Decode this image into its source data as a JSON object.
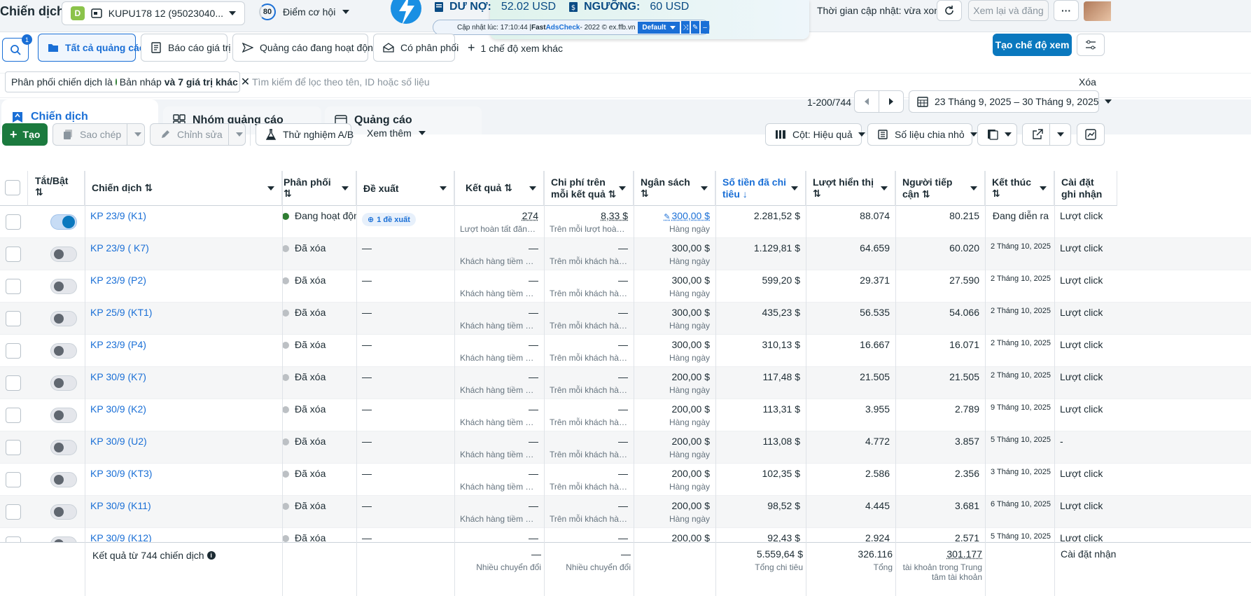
{
  "header": {
    "title": "Chiến dịch",
    "account_badge": "D",
    "account_name": "KUPU178 12 (95023040...",
    "score": "80",
    "opportunity_label": "Điểm cơ hội",
    "update_time": "Thời gian cập nhật: vừa xong",
    "review_publish": "Xem lại và đăng",
    "more": "···"
  },
  "adscheck": {
    "debt_label": "DƯ NỢ:",
    "debt_value": "52.02 USD",
    "threshold_label": "NGƯỠNG:",
    "threshold_value": "60 USD",
    "update_prefix": "Cập nhật lúc: 17:10:44 | ",
    "brand_fast": "Fast ",
    "brand_ads": "AdsCheck",
    "update_suffix": " - 2022 © ex.ffb.vn",
    "profile": "Default"
  },
  "toolbar": {
    "search_badge": "1",
    "views": [
      "Tất cả quảng cáo",
      "Báo cáo giá trị",
      "Quảng cáo đang hoạt động",
      "Có phân phối"
    ],
    "more_views": "1 chế độ xem khác",
    "create_view": "Tạo chế độ xem"
  },
  "filter": {
    "chip_prefix": "Phân phối chiến dịch là",
    "chip_value": "Bản nháp",
    "chip_suffix": "và 7 giá trị khác",
    "placeholder": "Tìm kiếm để lọc theo tên, ID hoặc số liệu",
    "clear": "Xóa"
  },
  "tabs": [
    "Chiến dịch",
    "Nhóm quảng cáo",
    "Quảng cáo"
  ],
  "pagination": {
    "range": "1-200/744",
    "date_range": "23 Tháng 9, 2025 – 30 Tháng 9, 2025"
  },
  "actions": {
    "create": "Tạo",
    "duplicate": "Sao chép",
    "edit": "Chỉnh sửa",
    "ab_test": "Thử nghiệm A/B",
    "see_more": "Xem thêm",
    "columns": "Cột: Hiệu quả",
    "breakdown": "Số liệu chia nhỏ"
  },
  "columns": {
    "toggle": "Tắt/Bật ⇅",
    "campaign": "Chiến dịch ⇅",
    "delivery": "Phân phối ⇅",
    "recommendations": "Đề xuất",
    "results": "Kết quả ⇅",
    "cost_per_result": "Chi phí trên mỗi kết quả ⇅",
    "budget": "Ngân sách ⇅",
    "amount_spent": "Số tiền đã chi tiêu ↓",
    "impressions": "Lượt hiển thị ⇅",
    "reach": "Người tiếp cận ⇅",
    "ends": "Kết thúc ⇅",
    "attribution": "Cài đặt ghi nhận"
  },
  "rows": [
    {
      "name": "KP 23/9 (K1)",
      "on": true,
      "status": "Đang hoạt động",
      "status_color": "#2e7d32",
      "rec": "1 đề xuất",
      "result": "274",
      "result_sub": "Lượt hoàn tất đăng ký",
      "cpr": "8,33 $",
      "cpr_sub": "Trên mỗi lượt hoàn tất",
      "budget": "300,00 $",
      "budget_sub": "Hàng ngày",
      "spent": "2.281,52 $",
      "impr": "88.074",
      "reach": "80.215",
      "ends": "Đang diễn ra",
      "attr": "Lượt click"
    },
    {
      "name": "KP 23/9 ( K7)",
      "on": false,
      "status": "Đã xóa",
      "status_color": "#bcc0c4",
      "rec": "—",
      "result": "—",
      "result_sub": "Khách hàng tiềm năng",
      "cpr": "—",
      "cpr_sub": "Trên mỗi khách hàng tiềm năng",
      "budget": "300,00 $",
      "budget_sub": "Hàng ngày",
      "spent": "1.129,81 $",
      "impr": "64.659",
      "reach": "60.020",
      "ends": "2 Tháng 10, 2025",
      "attr": "Lượt click"
    },
    {
      "name": "KP 23/9 (P2)",
      "on": false,
      "status": "Đã xóa",
      "status_color": "#bcc0c4",
      "rec": "—",
      "result": "—",
      "result_sub": "Khách hàng tiềm năng",
      "cpr": "—",
      "cpr_sub": "Trên mỗi khách hàng tiềm năng",
      "budget": "300,00 $",
      "budget_sub": "Hàng ngày",
      "spent": "599,20 $",
      "impr": "29.371",
      "reach": "27.590",
      "ends": "2 Tháng 10, 2025",
      "attr": "Lượt click"
    },
    {
      "name": "KP 25/9 (KT1)",
      "on": false,
      "status": "Đã xóa",
      "status_color": "#bcc0c4",
      "rec": "—",
      "result": "—",
      "result_sub": "Khách hàng tiềm năng",
      "cpr": "—",
      "cpr_sub": "Trên mỗi khách hàng tiềm năng",
      "budget": "300,00 $",
      "budget_sub": "Hàng ngày",
      "spent": "435,23 $",
      "impr": "56.535",
      "reach": "54.066",
      "ends": "2 Tháng 10, 2025",
      "attr": "Lượt click"
    },
    {
      "name": "KP 23/9 (P4)",
      "on": false,
      "status": "Đã xóa",
      "status_color": "#bcc0c4",
      "rec": "—",
      "result": "—",
      "result_sub": "Khách hàng tiềm năng",
      "cpr": "—",
      "cpr_sub": "Trên mỗi khách hàng tiềm năng",
      "budget": "300,00 $",
      "budget_sub": "Hàng ngày",
      "spent": "310,13 $",
      "impr": "16.667",
      "reach": "16.071",
      "ends": "2 Tháng 10, 2025",
      "attr": "Lượt click"
    },
    {
      "name": "KP 30/9 (K7)",
      "on": false,
      "status": "Đã xóa",
      "status_color": "#bcc0c4",
      "rec": "—",
      "result": "—",
      "result_sub": "Khách hàng tiềm năng",
      "cpr": "—",
      "cpr_sub": "Trên mỗi khách hàng tiềm năng",
      "budget": "200,00 $",
      "budget_sub": "Hàng ngày",
      "spent": "117,48 $",
      "impr": "21.505",
      "reach": "21.505",
      "ends": "2 Tháng 10, 2025",
      "attr": "Lượt click"
    },
    {
      "name": "KP 30/9 (K2)",
      "on": false,
      "status": "Đã xóa",
      "status_color": "#bcc0c4",
      "rec": "—",
      "result": "—",
      "result_sub": "Khách hàng tiềm năng",
      "cpr": "—",
      "cpr_sub": "Trên mỗi khách hàng tiềm năng",
      "budget": "200,00 $",
      "budget_sub": "Hàng ngày",
      "spent": "113,31 $",
      "impr": "3.955",
      "reach": "2.789",
      "ends": "9 Tháng 10, 2025",
      "attr": "Lượt click"
    },
    {
      "name": "KP 30/9 (U2)",
      "on": false,
      "status": "Đã xóa",
      "status_color": "#bcc0c4",
      "rec": "—",
      "result": "—",
      "result_sub": "Khách hàng tiềm năng",
      "cpr": "—",
      "cpr_sub": "Trên mỗi khách hàng tiềm năng",
      "budget": "200,00 $",
      "budget_sub": "Hàng ngày",
      "spent": "113,08 $",
      "impr": "4.772",
      "reach": "3.857",
      "ends": "5 Tháng 10, 2025",
      "attr": "-"
    },
    {
      "name": "KP 30/9 (KT3)",
      "on": false,
      "status": "Đã xóa",
      "status_color": "#bcc0c4",
      "rec": "—",
      "result": "—",
      "result_sub": "Khách hàng tiềm năng",
      "cpr": "—",
      "cpr_sub": "Trên mỗi khách hàng tiềm năng",
      "budget": "200,00 $",
      "budget_sub": "Hàng ngày",
      "spent": "102,35 $",
      "impr": "2.586",
      "reach": "2.356",
      "ends": "3 Tháng 10, 2025",
      "attr": "Lượt click"
    },
    {
      "name": "KP 30/9 (K11)",
      "on": false,
      "status": "Đã xóa",
      "status_color": "#bcc0c4",
      "rec": "—",
      "result": "—",
      "result_sub": "Khách hàng tiềm năng",
      "cpr": "—",
      "cpr_sub": "Trên mỗi khách hàng tiềm năng",
      "budget": "200,00 $",
      "budget_sub": "Hàng ngày",
      "spent": "98,52 $",
      "impr": "4.445",
      "reach": "3.681",
      "ends": "6 Tháng 10, 2025",
      "attr": "Lượt click"
    },
    {
      "name": "KP 30/9 (K12)",
      "on": false,
      "status": "Đã xóa",
      "status_color": "#bcc0c4",
      "rec": "—",
      "result": "—",
      "result_sub": "",
      "cpr": "—",
      "cpr_sub": "",
      "budget": "200,00 $",
      "budget_sub": "",
      "spent": "92,43 $",
      "impr": "2.924",
      "reach": "2.571",
      "ends": "5 Tháng 10, 2025",
      "attr": "Lượt click"
    }
  ],
  "footer": {
    "label": "Kết quả từ 744 chiến dịch",
    "results": "—",
    "results_sub": "Nhiều chuyển đổi",
    "cpr": "—",
    "cpr_sub": "Nhiều chuyển đổi",
    "spent": "5.559,64 $",
    "spent_sub": "Tổng chi tiêu",
    "impr": "326.116",
    "impr_sub": "Tổng",
    "reach": "301.177",
    "reach_sub": "tài khoản trong Trung tâm tài khoản",
    "attr": "Cài đặt nhận"
  },
  "colors": {
    "primary": "#0a78be",
    "create_green": "#1b7a3e",
    "link": "#1a6fd6"
  }
}
